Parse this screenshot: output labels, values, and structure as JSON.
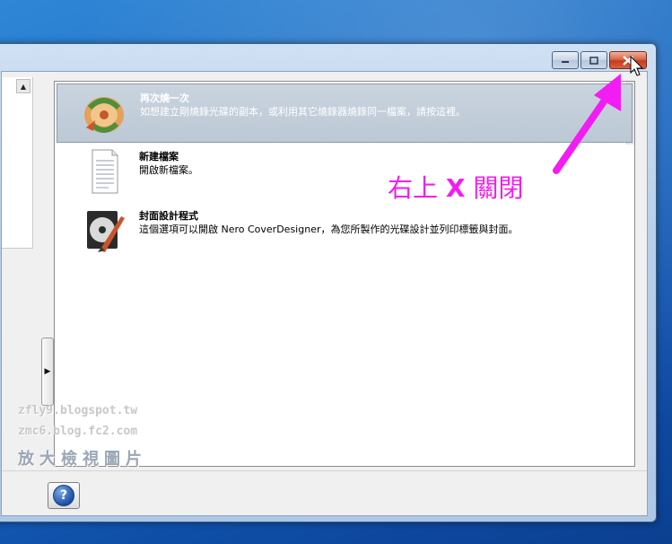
{
  "titlebar": {
    "minimize_icon": "minimize-icon",
    "maximize_icon": "maximize-icon",
    "close_icon": "close-icon"
  },
  "items": [
    {
      "title": "再次燒一次",
      "desc": "如想建立剛燒錄光碟的副本，或利用其它燒錄器燒錄同一檔案，請按這裡。",
      "icon": "reburn-icon",
      "selected": true
    },
    {
      "title": "新建檔案",
      "desc": "開啟新檔案。",
      "icon": "new-document-icon",
      "selected": false
    },
    {
      "title": "封面設計程式",
      "desc": "這個選項可以開啟 Nero CoverDesigner，為您所製作的光碟設計並列印標籤與封面。",
      "icon": "cover-designer-icon",
      "selected": false
    }
  ],
  "annotation": {
    "prefix": "右上 ",
    "x": "X",
    "suffix": " 關閉",
    "color": "#f21df2"
  },
  "watermark": {
    "line1": "zfly9.blogspot.tw",
    "line2": "zmc6.blog.fc2.com",
    "line3": "放大檢視圖片"
  },
  "help_button": {
    "label": "?"
  },
  "colors": {
    "selected_row": "#bcc8d5",
    "close_button": "#c23c1d"
  }
}
